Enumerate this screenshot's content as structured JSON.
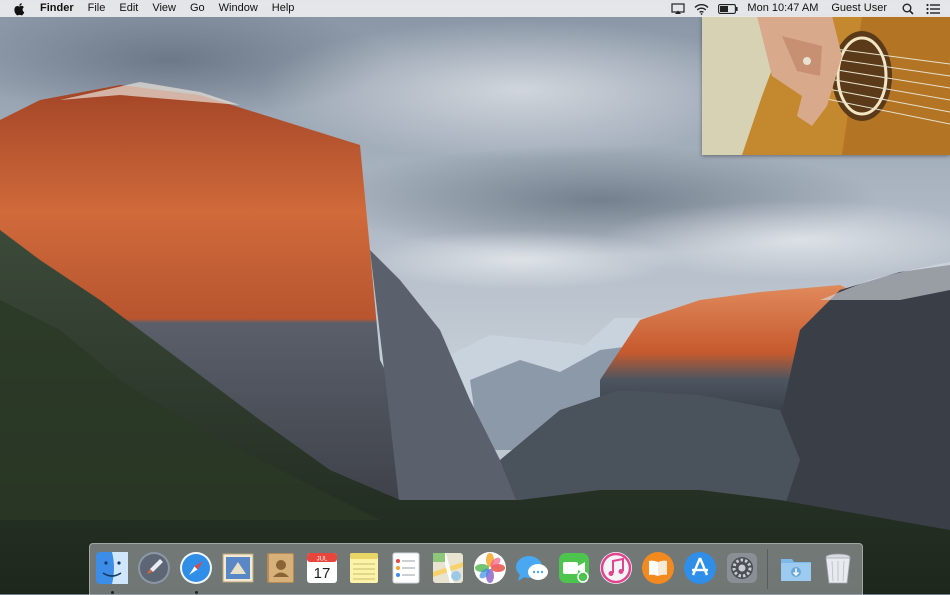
{
  "menubar": {
    "app_name": "Finder",
    "menus": [
      "File",
      "Edit",
      "View",
      "Go",
      "Window",
      "Help"
    ],
    "clock": "Mon 10:47 AM",
    "user": "Guest User",
    "status_icons": [
      "airplay-icon",
      "wifi-icon",
      "battery-icon",
      "spotlight-icon",
      "notification-center-icon"
    ]
  },
  "calendar": {
    "month": "JUL",
    "day": "17"
  },
  "dock": {
    "apps": [
      "finder",
      "launchpad",
      "safari",
      "mail",
      "contacts",
      "calendar",
      "notes",
      "reminders",
      "maps",
      "photos",
      "messages",
      "facetime",
      "itunes",
      "ibooks",
      "app-store",
      "system-preferences"
    ],
    "running": [
      "finder",
      "safari"
    ],
    "stack": [
      "downloads-folder",
      "trash"
    ]
  },
  "colors": {
    "menubar_bg": "#ececee",
    "sky": "#9aa7b6",
    "rock_sunlit": "#c65a2e",
    "forest": "#2f3e2a"
  }
}
